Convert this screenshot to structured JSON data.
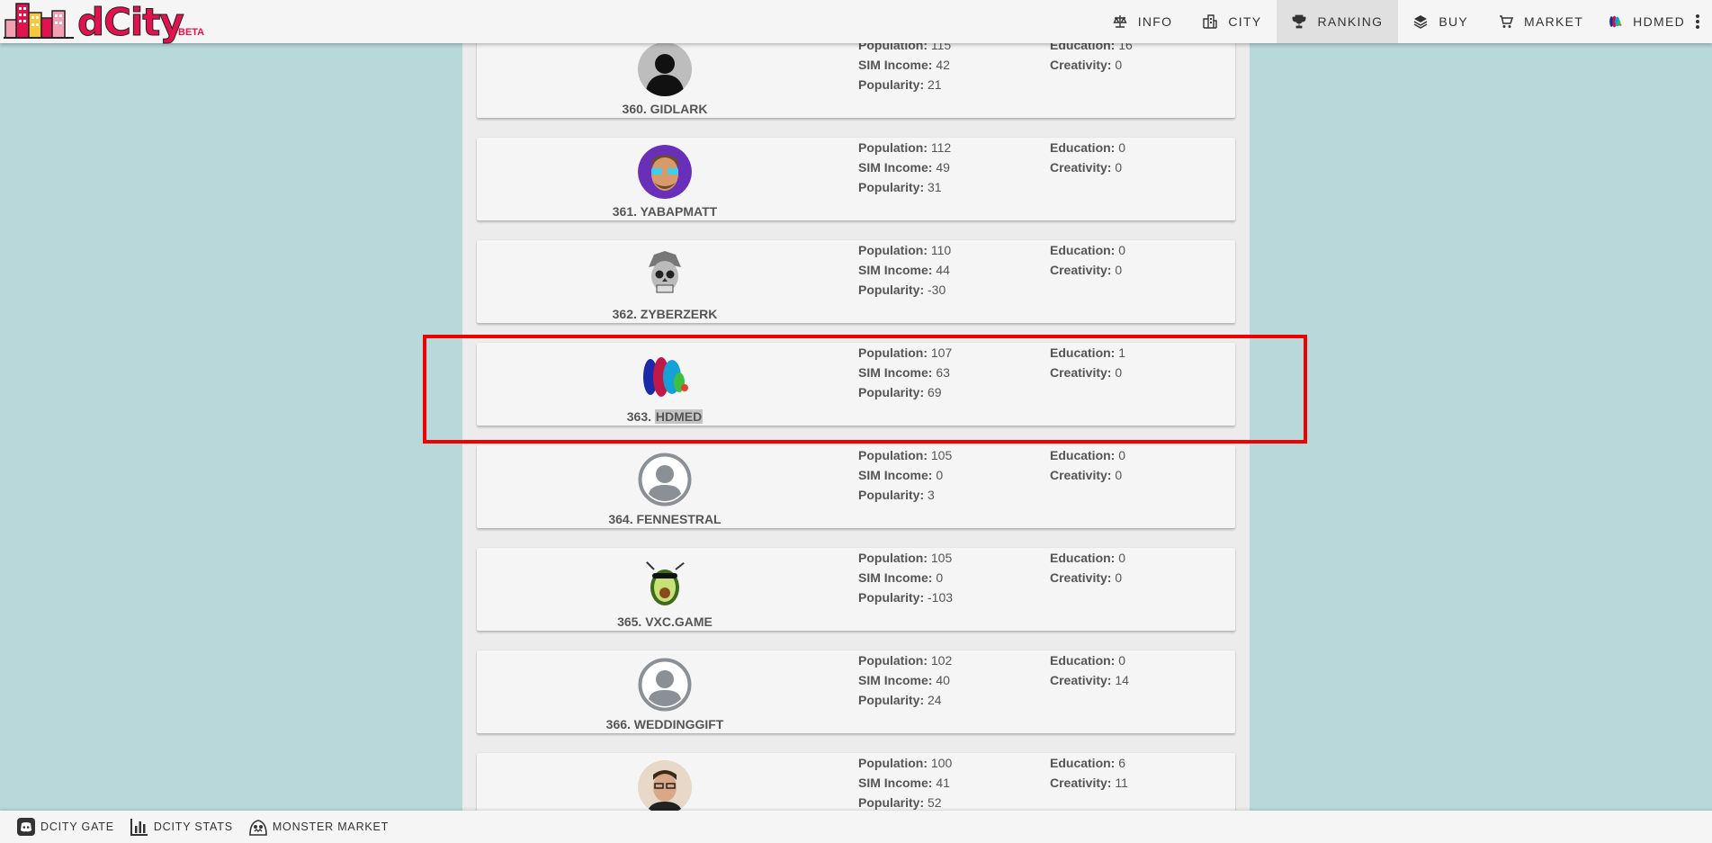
{
  "app": {
    "logo_text": "dCity",
    "logo_badge": "BETA"
  },
  "nav": {
    "info": "INFO",
    "city": "CITY",
    "ranking": "RANKING",
    "buy": "BUY",
    "market": "MARKET",
    "user": "HDMED"
  },
  "labels": {
    "population": "Population:",
    "sim_income": "SIM Income:",
    "popularity": "Popularity:",
    "education": "Education:",
    "creativity": "Creativity:"
  },
  "rankings": [
    {
      "rank": "360.",
      "name": "GIDLARK",
      "population": "115",
      "sim_income": "42",
      "popularity": "21",
      "education": "16",
      "creativity": "0",
      "avatar": "silhouette-photo"
    },
    {
      "rank": "361.",
      "name": "YABAPMATT",
      "population": "112",
      "sim_income": "49",
      "popularity": "31",
      "education": "0",
      "creativity": "0",
      "avatar": "cartoon-man"
    },
    {
      "rank": "362.",
      "name": "ZYBERZERK",
      "population": "110",
      "sim_income": "44",
      "popularity": "-30",
      "education": "0",
      "creativity": "0",
      "avatar": "skull-helmet"
    },
    {
      "rank": "363.",
      "name": "HDMED",
      "population": "107",
      "sim_income": "63",
      "popularity": "69",
      "education": "1",
      "creativity": "0",
      "avatar": "hd-logo"
    },
    {
      "rank": "364.",
      "name": "FENNESTRAL",
      "population": "105",
      "sim_income": "0",
      "popularity": "3",
      "education": "0",
      "creativity": "0",
      "avatar": "default-user"
    },
    {
      "rank": "365.",
      "name": "VXC.GAME",
      "population": "105",
      "sim_income": "0",
      "popularity": "-103",
      "education": "0",
      "creativity": "0",
      "avatar": "avocado"
    },
    {
      "rank": "366.",
      "name": "WEDDINGGIFT",
      "population": "102",
      "sim_income": "40",
      "popularity": "24",
      "education": "0",
      "creativity": "14",
      "avatar": "default-user"
    },
    {
      "rank": "",
      "name": "",
      "population": "100",
      "sim_income": "41",
      "popularity": "52",
      "education": "6",
      "creativity": "11",
      "avatar": "man-photo"
    }
  ],
  "footer": {
    "gate": "DCITY GATE",
    "stats": "DCITY STATS",
    "monster": "MONSTER MARKET"
  },
  "colors": {
    "background": "#b8d8da",
    "highlight": "#ee0000",
    "logo": "#e0134f"
  }
}
